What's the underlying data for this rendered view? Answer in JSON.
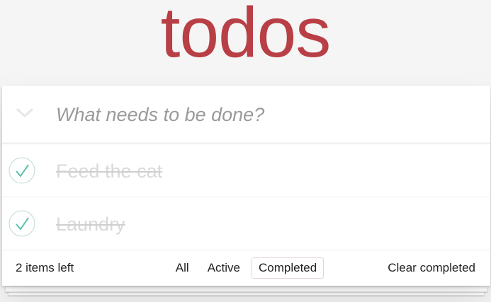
{
  "header": {
    "title": "todos",
    "new_todo_placeholder": "What needs to be done?"
  },
  "todos": [
    {
      "label": "Feed the cat",
      "completed": true
    },
    {
      "label": "Laundry",
      "completed": true
    }
  ],
  "footer": {
    "items_left": "2 items left",
    "filters": [
      "All",
      "Active",
      "Completed"
    ],
    "selected_filter": "Completed",
    "clear_completed": "Clear completed"
  },
  "colors": {
    "title": "#b83f45",
    "check": "#5dc2af",
    "check_ring": "#bddad5",
    "completed_text": "#d9d9d9"
  },
  "icons": {
    "toggle_all": "chevron-down-icon",
    "todo_toggle": "checkmark-circle-icon"
  }
}
